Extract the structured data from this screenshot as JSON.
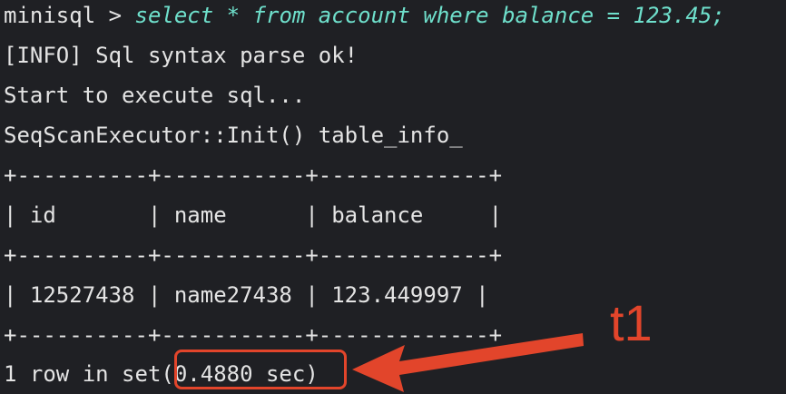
{
  "terminal": {
    "prompt": "minisql > ",
    "command": "select * from account where balance = 123.45;",
    "lines": [
      "[INFO] Sql syntax parse ok!",
      "Start to execute sql...",
      "SeqScanExecutor::Init() table_info_",
      "+----------+-----------+-------------+",
      "| id       | name      | balance     |",
      "+----------+-----------+-------------+",
      "| 12527438 | name27438 | 123.449997 |",
      "+----------+-----------+-------------+"
    ],
    "result_prefix": "1 row in set",
    "result_time": "(0.4880 sec)"
  },
  "annotation": {
    "label": "t1",
    "color": "#e2452b"
  }
}
